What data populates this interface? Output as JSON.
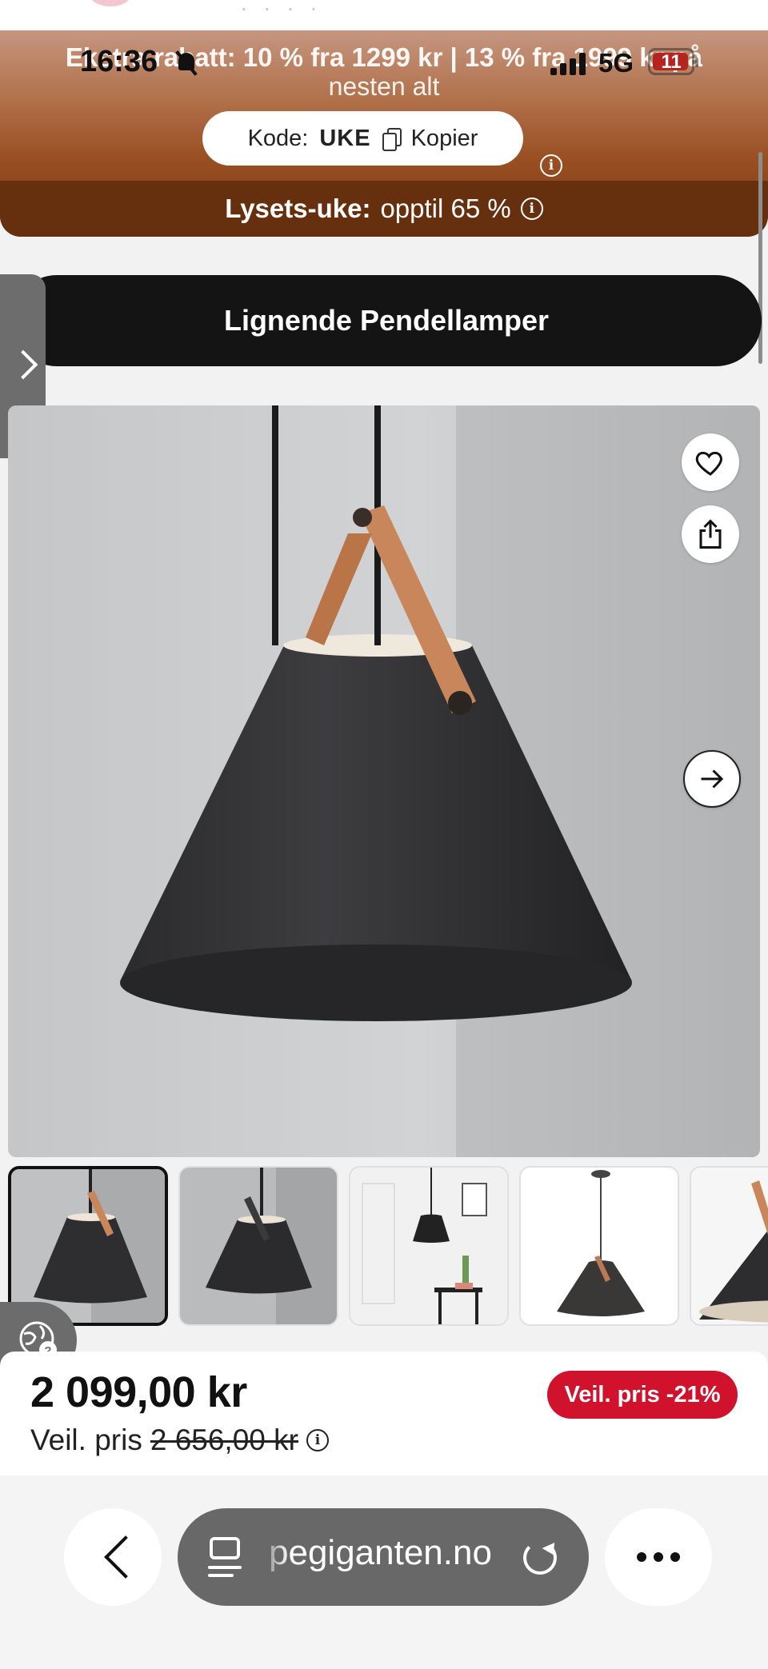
{
  "status_bar": {
    "time": "16:36",
    "network": "5G",
    "battery": "11"
  },
  "promo": {
    "text_line1": "Ekstra rabatt: 10 % fra 1299 kr | 13 % fra 1999 kr på",
    "text_line2": "nesten alt",
    "code_label": "Kode:",
    "code_value": "UKE",
    "copy_label": "Kopier",
    "week_title": "Lysets-uke:",
    "week_text": "opptil 65 %"
  },
  "similar_button": "Lignende Pendellamper",
  "product": {
    "price": "2 099,00 kr",
    "rrp_label": "Veil. pris",
    "rrp_value": "2 656,00 kr",
    "discount_badge": "Veil. pris -21%"
  },
  "browser": {
    "url": "pegiganten.no"
  },
  "colors": {
    "banner_top": "#c59680",
    "banner_bottom": "#66300f",
    "badge_red": "#d0122c",
    "pill_black": "#141414"
  },
  "icons": [
    "bell-muted-icon",
    "signal-icon",
    "battery-icon",
    "copy-icon",
    "info-icon",
    "chevron-right-icon",
    "heart-icon",
    "share-icon",
    "arrow-right-icon",
    "globe-icon",
    "chevron-left-icon",
    "tabs-icon",
    "reload-icon",
    "more-icon"
  ]
}
